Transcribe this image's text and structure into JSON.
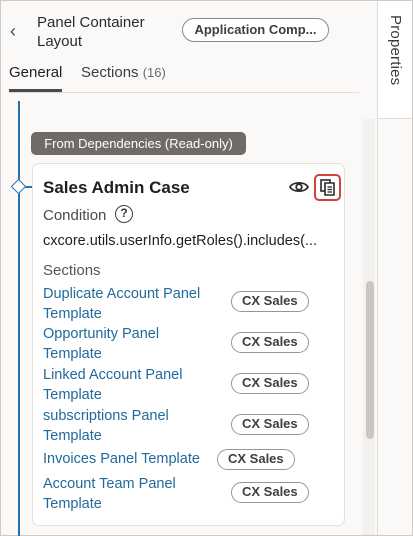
{
  "header": {
    "title": "Panel Container Layout",
    "app_component_label": "Application Comp..."
  },
  "tabs": [
    {
      "label": "General"
    },
    {
      "label": "Sections",
      "count": "(16)"
    }
  ],
  "right_rail": {
    "label": "Properties"
  },
  "dependency_badge": "From Dependencies (Read-only)",
  "card": {
    "title": "Sales Admin Case",
    "condition_label": "Condition",
    "help_glyph": "?",
    "condition_value": "cxcore.utils.userInfo.getRoles().includes(...",
    "sections_label": "Sections",
    "sections": [
      {
        "name": "Duplicate Account Panel Template",
        "badge": "CX Sales"
      },
      {
        "name": "Opportunity Panel Template",
        "badge": "CX Sales"
      },
      {
        "name": "Linked Account Panel Template",
        "badge": "CX Sales"
      },
      {
        "name": "subscriptions Panel Template",
        "badge": "CX Sales"
      },
      {
        "name": "Invoices Panel Template",
        "badge": "CX Sales"
      },
      {
        "name": "Account Team Panel Template",
        "badge": "CX Sales"
      }
    ]
  },
  "icons": {
    "back": "chevron-left-icon",
    "eye": "eye-icon",
    "copy": "duplicate-icon",
    "help": "help-icon"
  },
  "colors": {
    "link": "#216a9c",
    "tree_accent": "#2a6fb0",
    "highlight": "#c8463c",
    "badge_dark": "#6f6b67"
  }
}
